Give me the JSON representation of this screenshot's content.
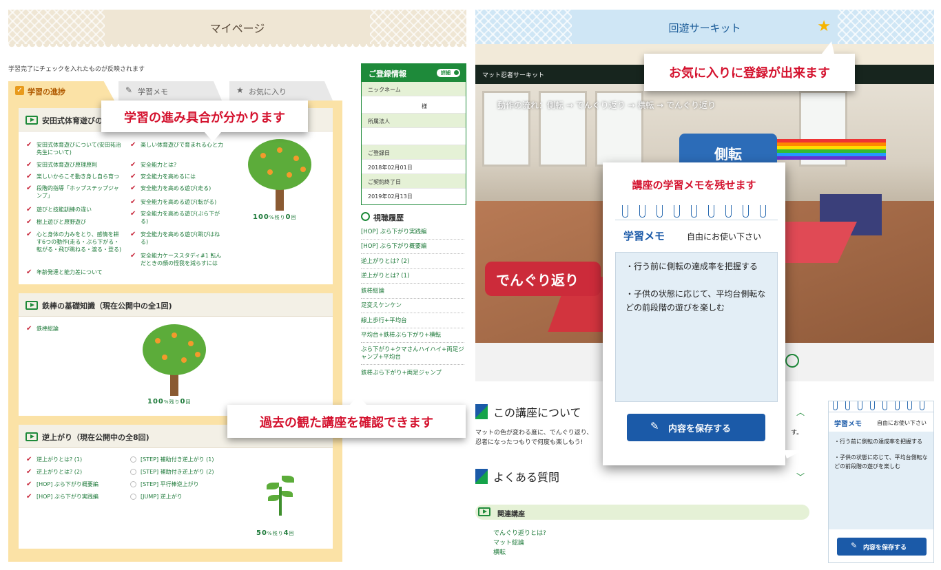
{
  "left": {
    "header_title": "マイページ",
    "notice": "学習完了にチェックを入れたものが反映されます",
    "tabs": [
      {
        "label": "学習の進捗",
        "icon": "check-box-icon"
      },
      {
        "label": "学習メモ",
        "icon": "pencil-icon"
      },
      {
        "label": "お気に入り",
        "icon": "star-icon"
      }
    ],
    "courses": [
      {
        "title": "安田式体育遊びの",
        "percent": "100",
        "percent_unit": "%残り",
        "remain": "0",
        "remain_unit": "回",
        "col1": [
          "安田式体育遊びについて(安田祐治先生について)",
          "安田式体育遊び原理原則",
          "楽しいからこそ動き身し自ら育つ",
          "段階的指導「ホップステップジャンプ」",
          "遊びと技能訓練の違い",
          "樹上遊びと原野遊び",
          "心と身体の力みをとり、感情を耕す6つの動作(走る・ぶら下がる・転がる・飛び跳ねる・渡る・登る)",
          "年齢発達と能力差について"
        ],
        "col2": [
          "楽しい体育遊びで育まれる心と力",
          "安全能力とは?",
          "安全能力を高めるには",
          "安全能力を高める遊び(走る)",
          "安全能力を高める遊び(転がる)",
          "安全能力を高める遊び(ぶら下がる)",
          "安全能力を高める遊び(跳びはねる)",
          "安全能力ケーススタディ#1 転んだときの顔の怪我を減らすには"
        ]
      },
      {
        "title": "鉄棒の基礎知識（現在公開中の全1回)",
        "percent": "100",
        "percent_unit": "%残り",
        "remain": "0",
        "remain_unit": "回",
        "col1": [
          "鉄棒総論"
        ]
      },
      {
        "title": "逆上がり（現在公開中の全8回)",
        "percent": "50",
        "percent_unit": "%残り",
        "remain": "4",
        "remain_unit": "回",
        "col1": [
          "逆上がりとは? (1)",
          "逆上がりとは? (2)",
          "[HOP] ぶら下がり概要編",
          "[HOP] ぶら下がり実践編"
        ],
        "col2": [
          "[STEP] 補助付き逆上がり (1)",
          "[STEP] 補助付き逆上がり (2)",
          "[STEP] 平行棒逆上がり",
          "[JUMP] 逆上がり"
        ]
      }
    ],
    "callout_progress": "学習の進み具合が分かります",
    "callout_history": "過去の観た講座を確認できます",
    "registration": {
      "title": "ご登録情報",
      "detail_label": "詳細",
      "nickname_label": "ニックネーム",
      "nickname_suffix": "様",
      "org_label": "所属法人",
      "reg_date_label": "ご登録日",
      "reg_date": "2018年02月01日",
      "end_date_label": "ご契約終了日",
      "end_date": "2019年02月13日"
    },
    "history": {
      "title": "視聴履歴",
      "items": [
        "[HOP] ぶら下がり実践編",
        "[HOP] ぶら下がり概要編",
        "逆上がりとは? (2)",
        "逆上がりとは? (1)",
        "鉄棒総論",
        "足変えケンケン",
        "線上歩行+平均台",
        "平均台+鉄棒ぶら下がり+横転",
        "ぶら下がり+クマさんハイハイ+両足ジャンプ+平均台",
        "鉄棒ぶら下がり+両足ジャンプ"
      ]
    }
  },
  "right": {
    "header_title": "回遊サーキット",
    "callout_favorite": "お気に入りに登録が出来ます",
    "video_title": "マット忍者サーキット",
    "video_flow": "動作の流れ：側転 → でんぐり返り → 横転 → でんぐり返り",
    "video_label_side": "側転",
    "video_label_roll": "でんぐり返り",
    "about_title": "この講座について",
    "about_desc_1": "マットの色が変わる度に、でんぐり返り、",
    "about_desc_1b": "す。",
    "about_desc_2": "忍者になったつもりで何度も楽しもう!",
    "faq_title": "よくある質問",
    "related_title": "関連講座",
    "related_items": [
      "でんぐり返りとは?",
      "マット総論",
      "横転"
    ],
    "memo_caption": "講座の学習メモを残せます",
    "memo": {
      "title": "学習メモ",
      "subtitle": "自由にお使い下さい",
      "line1": "・行う前に側転の達成率を把握する",
      "line2": "・子供の状態に応じて、平均台側転などの前段階の遊びを楽しむ",
      "save_label": "内容を保存する"
    }
  },
  "colors": {
    "accent_green": "#1e8a3a",
    "accent_blue": "#1b5aa8",
    "callout_red": "#d4122e",
    "progress_bg": "#fbe2a6"
  }
}
